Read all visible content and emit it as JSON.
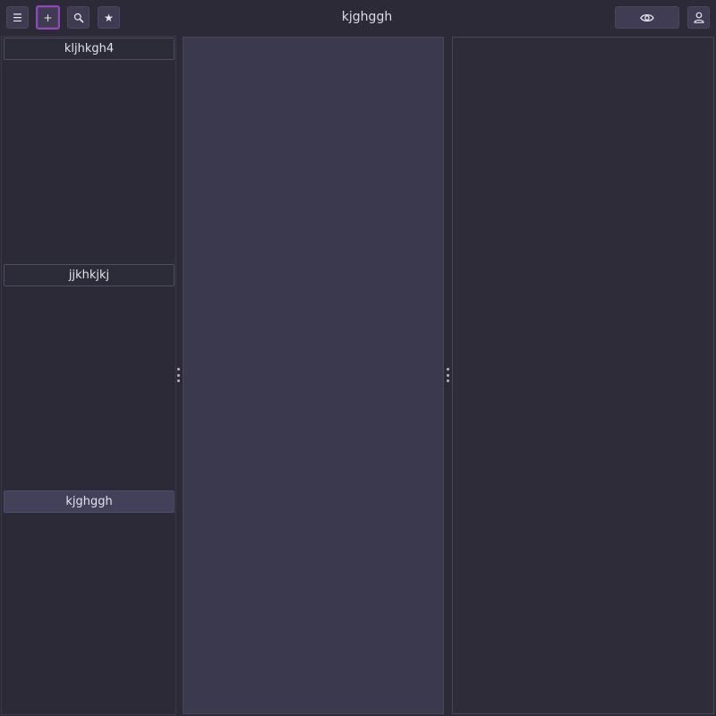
{
  "header": {
    "title": "kjghggh",
    "buttons": {
      "menu": {
        "icon": "menu-icon",
        "glyph": "☰"
      },
      "add": {
        "icon": "plus-icon",
        "glyph": "+"
      },
      "search": {
        "icon": "search-icon"
      },
      "favorite": {
        "icon": "star-icon",
        "glyph": "★"
      },
      "view": {
        "icon": "eye-icon"
      },
      "user": {
        "icon": "user-icon"
      }
    }
  },
  "sidebar": {
    "items": [
      {
        "label": "kljhkgh4",
        "selected": false
      },
      {
        "label": "jjkhkjkj",
        "selected": false
      },
      {
        "label": "kjghggh",
        "selected": true
      }
    ]
  },
  "colors": {
    "background": "#2b2a36",
    "panel_middle": "#3b394d",
    "accent_focus": "#8d4bb8",
    "button": "#3e3b52"
  }
}
